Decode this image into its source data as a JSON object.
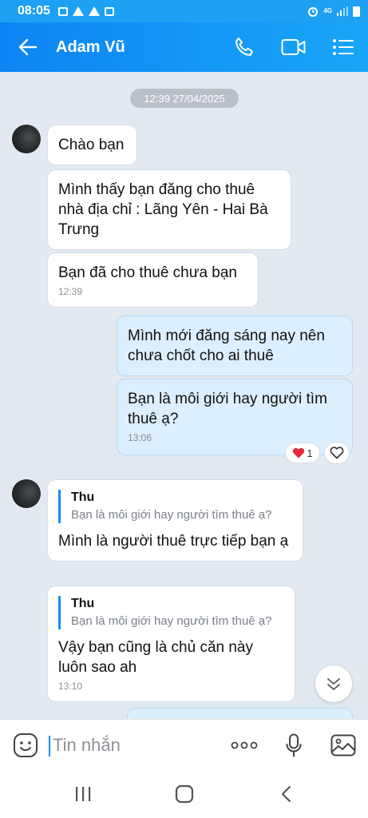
{
  "status_bar": {
    "time": "08:05",
    "network": "4G"
  },
  "header": {
    "contact_name": "Adam Vũ"
  },
  "chat": {
    "date_separator": "12:39 27/04/2025",
    "messages": [
      {
        "side": "them",
        "text": "Chào bạn"
      },
      {
        "side": "them",
        "text": "Mình thấy bạn đăng cho thuê nhà địa chỉ : Lãng Yên - Hai Bà Trưng"
      },
      {
        "side": "them",
        "text": "Bạn đã cho thuê chưa bạn",
        "time": "12:39"
      },
      {
        "side": "me",
        "text": "Mình mới đăng sáng nay nên chưa chốt cho ai thuê"
      },
      {
        "side": "me",
        "text": "Bạn là môi giới hay người tìm thuê ạ?",
        "time": "13:06",
        "reaction": {
          "icon": "heart-icon",
          "count": "1"
        }
      },
      {
        "side": "them",
        "quote_name": "Thu",
        "quote_text": "Bạn là môi giới hay người tìm thuê ạ?",
        "text": "Mình là người thuê trực tiếp bạn ạ"
      },
      {
        "side": "them",
        "quote_name": "Thu",
        "quote_text": "Bạn là môi giới hay người tìm thuê ạ?",
        "text": "Vậy bạn cũng là chủ căn này luôn sao ah",
        "time": "13:10"
      }
    ]
  },
  "input": {
    "placeholder": "Tin nhắn"
  },
  "colors": {
    "header_start": "#0d84f3",
    "header_end": "#19a6f8",
    "my_bubble": "#dbefff",
    "accent": "#1a8cf0",
    "heart": "#e8283a"
  }
}
